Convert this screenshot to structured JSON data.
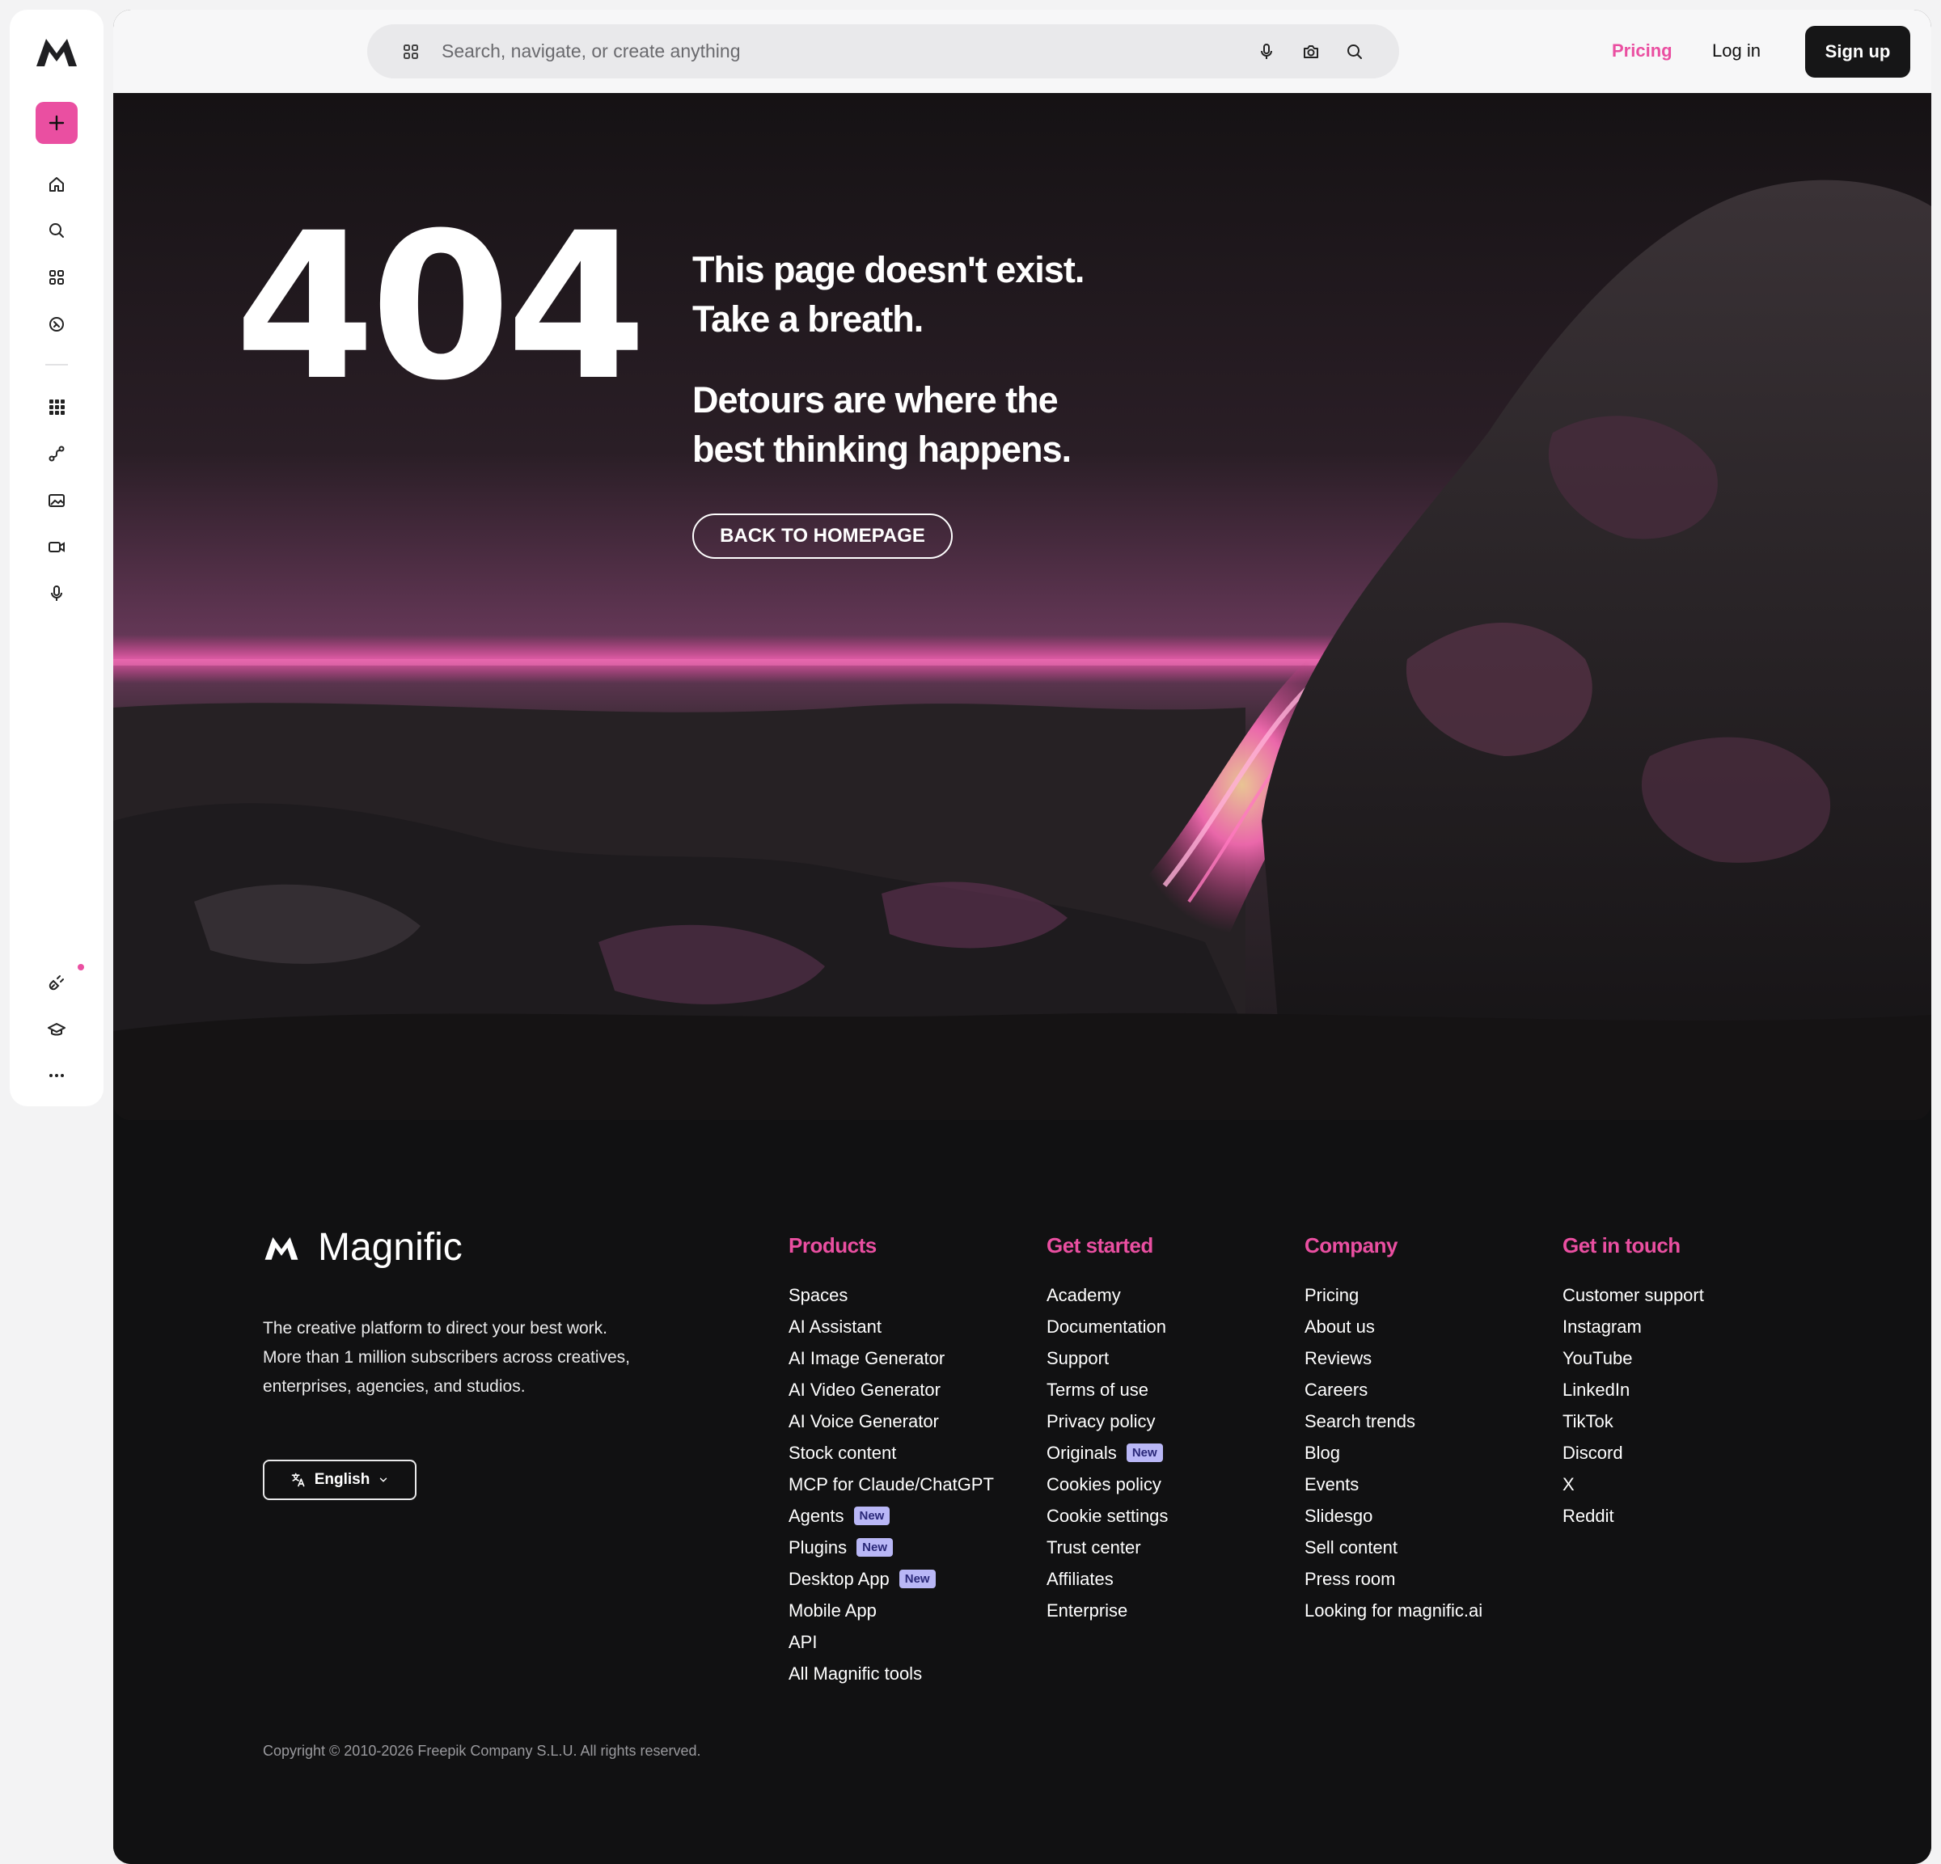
{
  "search": {
    "placeholder": "Search, navigate, or create anything"
  },
  "header": {
    "pricing_label": "Pricing",
    "login_label": "Log in",
    "signup_label": "Sign up"
  },
  "hero": {
    "code": "404",
    "message_1": "This page doesn't exist. Take a breath.",
    "message_2": "Detours are where the best thinking happens.",
    "button_label": "BACK TO HOMEPAGE"
  },
  "sidebar": {
    "icons": [
      "home-icon",
      "search-icon",
      "apps-icon",
      "explore-icon",
      "tools-grid-icon",
      "workflow-icon",
      "image-icon",
      "video-icon",
      "microphone-icon",
      "plugin-icon",
      "academy-icon",
      "more-icon"
    ]
  },
  "footer": {
    "brand_name": "Magnific",
    "tagline": "The creative platform to direct your best work. More than 1 million subscribers across creatives, enterprises, agencies, and studios.",
    "language": "English",
    "columns": [
      {
        "title": "Products",
        "links": [
          {
            "label": "Spaces"
          },
          {
            "label": "AI Assistant"
          },
          {
            "label": "AI Image Generator"
          },
          {
            "label": "AI Video Generator"
          },
          {
            "label": "AI Voice Generator"
          },
          {
            "label": "Stock content"
          },
          {
            "label": "MCP for Claude/ChatGPT"
          },
          {
            "label": "Agents",
            "badge": "New"
          },
          {
            "label": "Plugins",
            "badge": "New"
          },
          {
            "label": "Desktop App",
            "badge": "New"
          },
          {
            "label": "Mobile App"
          },
          {
            "label": "API"
          },
          {
            "label": "All Magnific tools"
          }
        ]
      },
      {
        "title": "Get started",
        "links": [
          {
            "label": "Academy"
          },
          {
            "label": "Documentation"
          },
          {
            "label": "Support"
          },
          {
            "label": "Terms of use"
          },
          {
            "label": "Privacy policy"
          },
          {
            "label": "Originals",
            "badge": "New"
          },
          {
            "label": "Cookies policy"
          },
          {
            "label": "Cookie settings"
          },
          {
            "label": "Trust center"
          },
          {
            "label": "Affiliates"
          },
          {
            "label": "Enterprise"
          }
        ]
      },
      {
        "title": "Company",
        "links": [
          {
            "label": "Pricing"
          },
          {
            "label": "About us"
          },
          {
            "label": "Reviews"
          },
          {
            "label": "Careers"
          },
          {
            "label": "Search trends"
          },
          {
            "label": "Blog"
          },
          {
            "label": "Events"
          },
          {
            "label": "Slidesgo"
          },
          {
            "label": "Sell content"
          },
          {
            "label": "Press room"
          },
          {
            "label": "Looking for magnific.ai"
          }
        ]
      },
      {
        "title": "Get in touch",
        "links": [
          {
            "label": "Customer support"
          },
          {
            "label": "Instagram"
          },
          {
            "label": "YouTube"
          },
          {
            "label": "LinkedIn"
          },
          {
            "label": "TikTok"
          },
          {
            "label": "Discord"
          },
          {
            "label": "X"
          },
          {
            "label": "Reddit"
          }
        ]
      }
    ],
    "copyright": "Copyright © 2010-2026 Freepik Company S.L.U. All rights reserved."
  },
  "colors": {
    "accent": "#ea4fa1",
    "dark": "#111112",
    "badge": "#b9b7f6"
  }
}
